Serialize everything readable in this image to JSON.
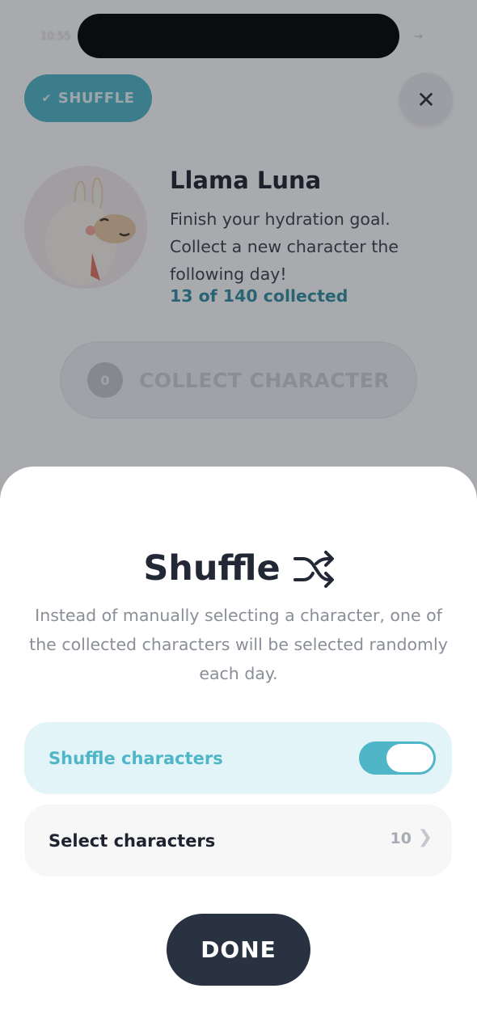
{
  "status_bar": {
    "time": "10:55",
    "signal": "→"
  },
  "header": {
    "shuffle_chip_label": "SHUFFLE",
    "shuffle_chip_check": "✔",
    "close_symbol": "✕"
  },
  "character": {
    "name": "Llama Luna",
    "description": "Finish your hydration goal. Collect a new character the following day!",
    "collected_text": "13 of 140 collected"
  },
  "collect_button": {
    "label": "COLLECT CHARACTER",
    "badge": "0"
  },
  "sheet": {
    "title": "Shuffle",
    "description": "Instead of manually selecting a character, one of the collected characters will be selected randomly each day.",
    "options": {
      "shuffle": {
        "label": "Shuffle characters",
        "enabled": true
      },
      "select": {
        "label": "Select characters",
        "count": "10",
        "chevron": "❯"
      }
    },
    "done_label": "DONE"
  },
  "colors": {
    "accent": "#4fb6c8",
    "dark_button": "#293241",
    "title_text": "#232836"
  },
  "icons": [
    "check-icon",
    "close-icon",
    "llama-avatar",
    "bear-icon",
    "shuffle-icon",
    "chevron-right-icon"
  ]
}
